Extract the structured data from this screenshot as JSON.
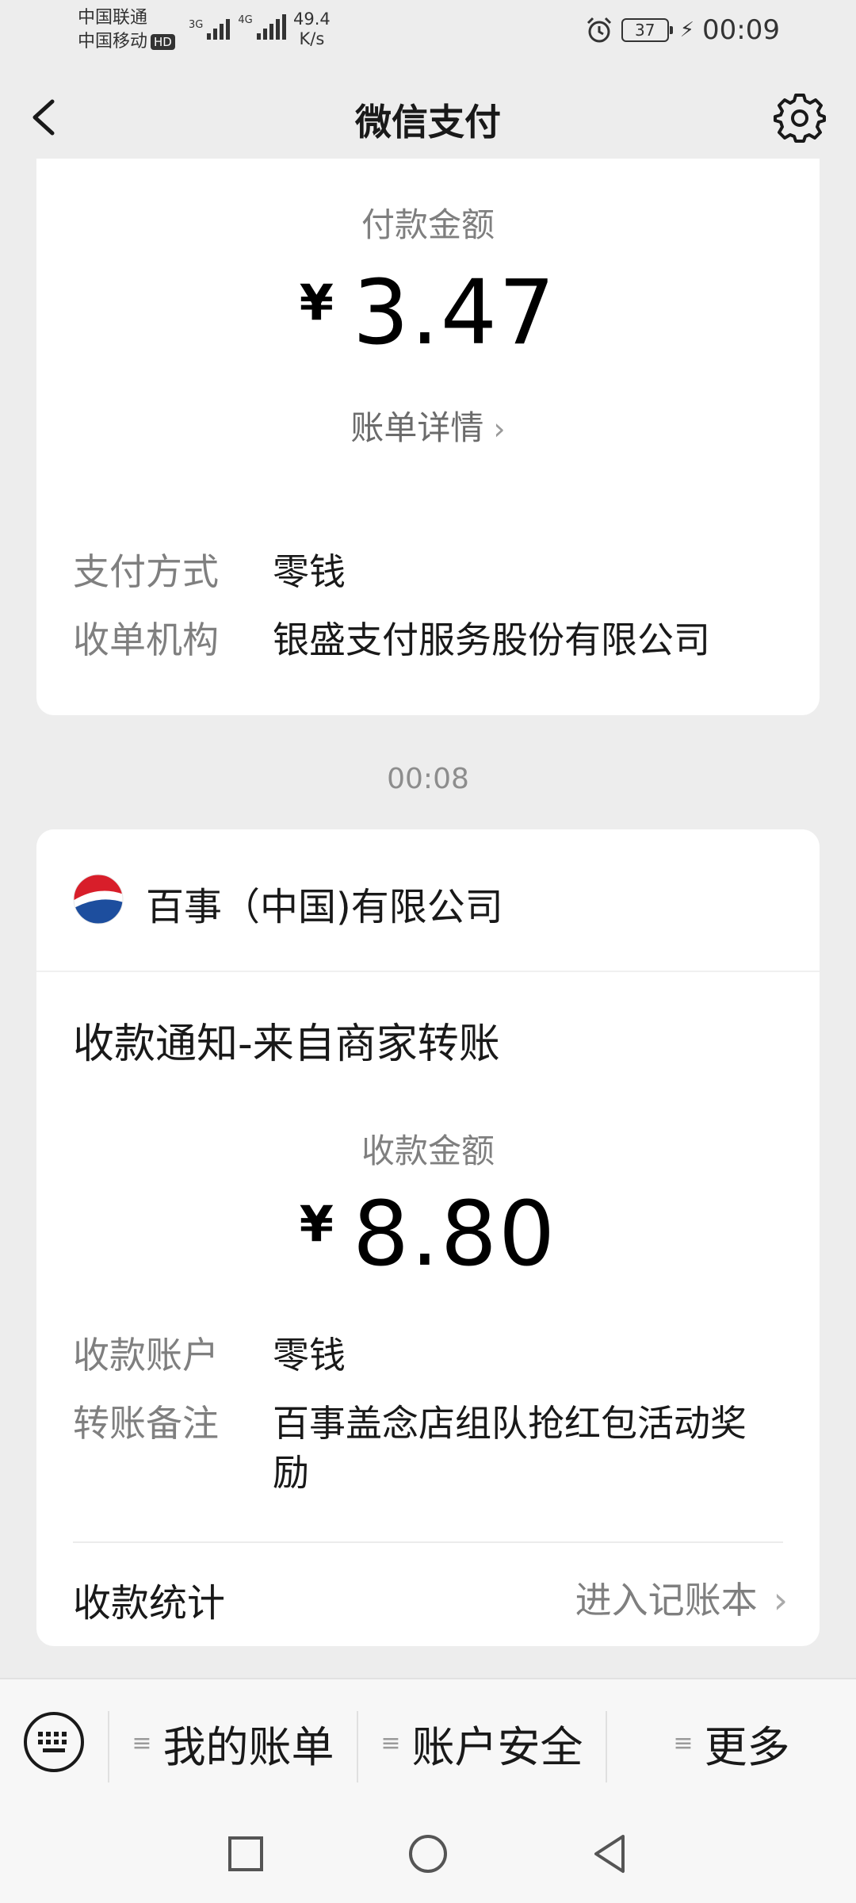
{
  "status_bar": {
    "carrier1": "中国联通",
    "carrier2": "中国移动",
    "hd": "HD",
    "net1": "3G",
    "net2": "4G",
    "speed_value": "49.4",
    "speed_unit": "K/s",
    "battery": "37",
    "time": "00:09"
  },
  "header": {
    "title": "微信支付"
  },
  "payment_card": {
    "amount_label": "付款金额",
    "currency": "¥",
    "amount": "3.47",
    "detail_link": "账单详情",
    "rows": [
      {
        "key": "支付方式",
        "value": "零钱"
      },
      {
        "key": "收单机构",
        "value": "银盛支付服务股份有限公司"
      }
    ]
  },
  "time_separator": "00:08",
  "receipt_card": {
    "merchant": "百事（中国)有限公司",
    "notice_title": "收款通知-来自商家转账",
    "amount_label": "收款金额",
    "currency": "¥",
    "amount": "8.80",
    "rows": [
      {
        "key": "收款账户",
        "value": "零钱"
      },
      {
        "key": "转账备注",
        "value": "百事盖念店组队抢红包活动奖励"
      }
    ],
    "stats_label": "收款统计",
    "stats_link": "进入记账本"
  },
  "bottom_menu": {
    "items": [
      "我的账单",
      "账户安全",
      "更多"
    ]
  },
  "colors": {
    "background": "#ededed",
    "card": "#ffffff",
    "secondary_text": "#7f7f7f",
    "pepsi_blue": "#1d4e9e",
    "pepsi_red": "#d81e2a"
  }
}
